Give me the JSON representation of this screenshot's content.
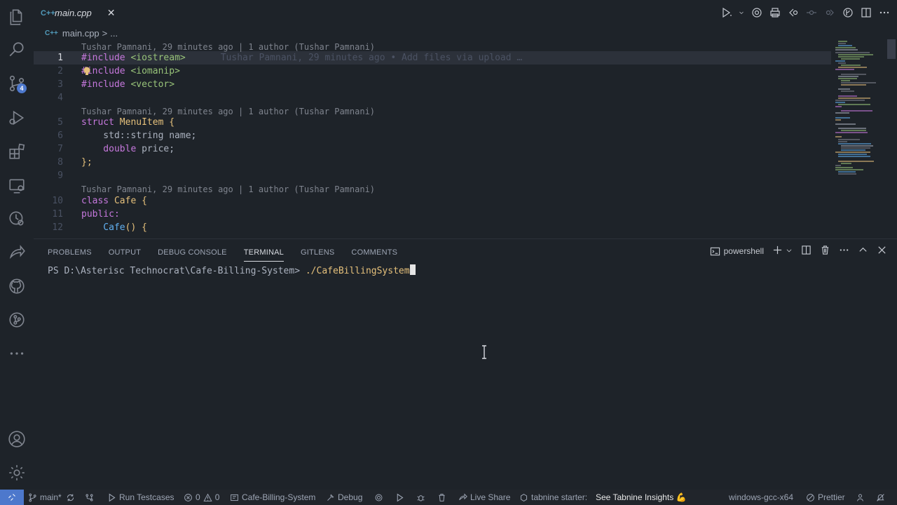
{
  "activity_bar": {
    "source_control_badge": "4"
  },
  "tabs": [
    {
      "icon": "C++",
      "label": "main.cpp",
      "close": "✕"
    }
  ],
  "breadcrumb": {
    "icon": "C++",
    "file": "main.cpp",
    "separator": ">",
    "more": "..."
  },
  "editor": {
    "codelens": [
      "Tushar Pamnani, 29 minutes ago | 1 author (Tushar Pamnani)",
      "Tushar Pamnani, 29 minutes ago | 1 author (Tushar Pamnani)",
      "Tushar Pamnani, 29 minutes ago | 1 author (Tushar Pamnani)"
    ],
    "inline_blame": "Tushar Pamnani, 29 minutes ago • Add files via upload …",
    "line_numbers": [
      "1",
      "2",
      "3",
      "4",
      "5",
      "6",
      "7",
      "8",
      "9",
      "10",
      "11",
      "12"
    ],
    "lines": {
      "l1_kw": "#include",
      "l1_str": "<iostream>",
      "l2_kw": "#include",
      "l2_str": "<iomanip>",
      "l3_kw": "#include",
      "l3_str": "<vector>",
      "l5_kw": "struct",
      "l5_name": "MenuItem",
      "l5_rest": " {",
      "l6": "    std::string name;",
      "l7_kw": "    double",
      "l7_rest": " price;",
      "l8": "};",
      "l10_kw": "class",
      "l10_name": "Cafe",
      "l10_rest": " {",
      "l11_kw": "public:",
      "l12_fn": "    Cafe",
      "l12_rest": "() {"
    }
  },
  "panel": {
    "tabs": [
      "PROBLEMS",
      "OUTPUT",
      "DEBUG CONSOLE",
      "TERMINAL",
      "GITLENS",
      "COMMENTS"
    ],
    "active_tab": "TERMINAL",
    "shell_name": "powershell",
    "terminal": {
      "prompt": "PS D:\\Asterisc Technocrat\\Cafe-Billing-System> ",
      "command": "./CafeBillingSystem"
    }
  },
  "status_bar": {
    "branch": "main*",
    "run_testcases": "Run Testcases",
    "errors": "0",
    "warnings": "0",
    "project": "Cafe-Billing-System",
    "debug": "Debug",
    "live_share": "Live Share",
    "tabnine": "tabnine starter:",
    "tabnine_insights": "See Tabnine Insights 💪",
    "compiler": "windows-gcc-x64",
    "prettier": "Prettier"
  },
  "colors": {
    "background": "#1e2329",
    "accent": "#4d78cc",
    "keyword": "#c678dd",
    "string": "#98c379",
    "type": "#e5c07b"
  }
}
